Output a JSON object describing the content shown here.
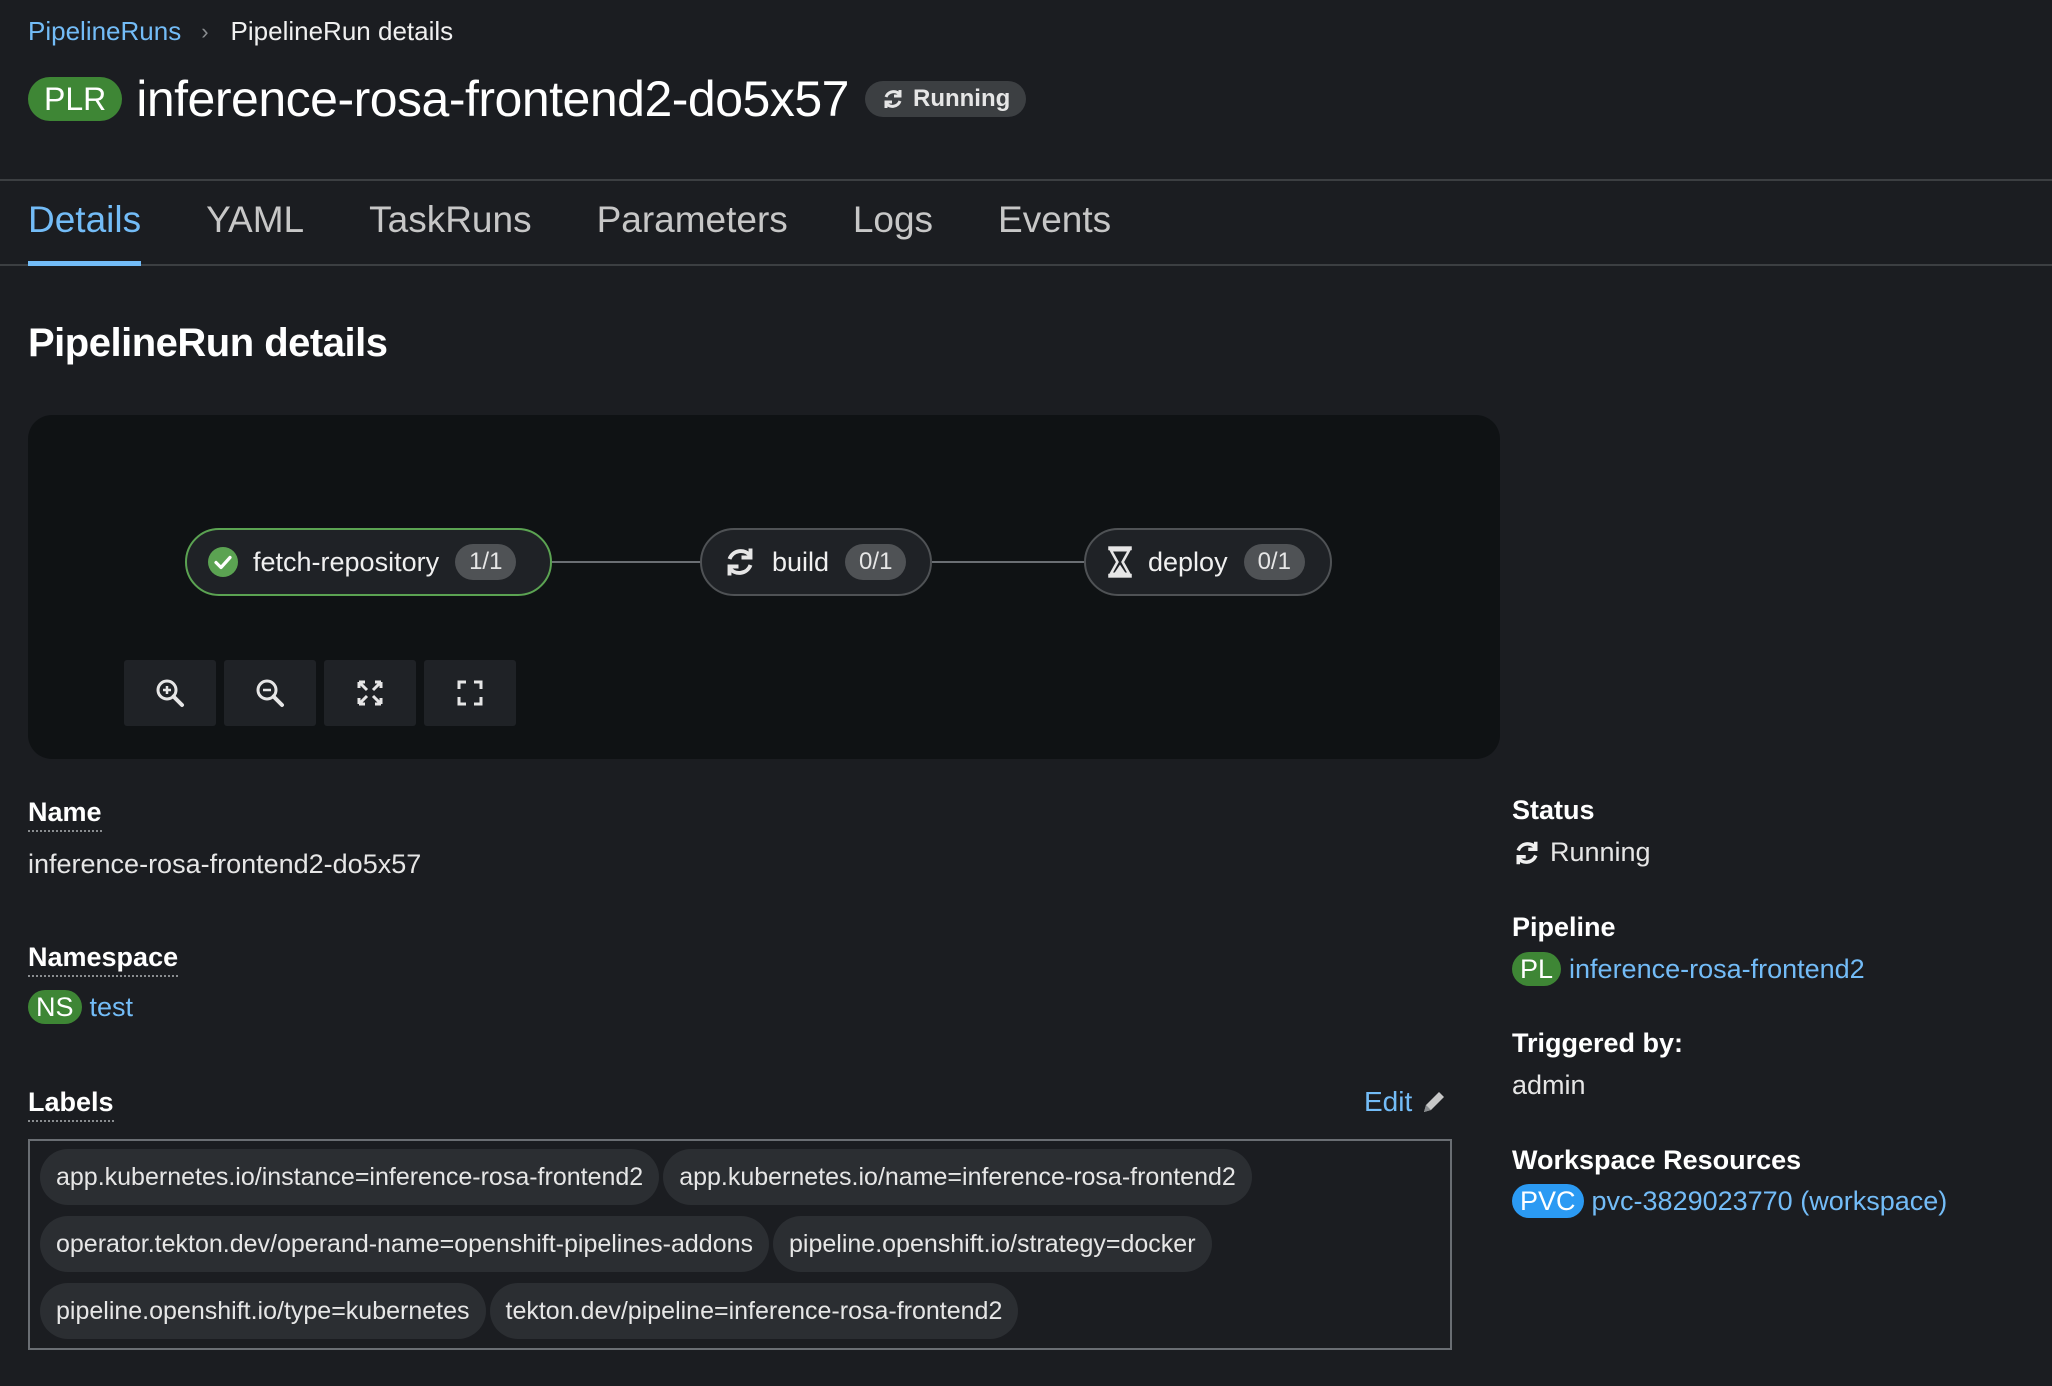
{
  "breadcrumb": {
    "parent": "PipelineRuns",
    "current": "PipelineRun details"
  },
  "header": {
    "badge": "PLR",
    "title": "inference-rosa-frontend2-do5x57",
    "status": "Running"
  },
  "tabs": [
    {
      "label": "Details",
      "active": true
    },
    {
      "label": "YAML",
      "active": false
    },
    {
      "label": "TaskRuns",
      "active": false
    },
    {
      "label": "Parameters",
      "active": false
    },
    {
      "label": "Logs",
      "active": false
    },
    {
      "label": "Events",
      "active": false
    }
  ],
  "section_title": "PipelineRun details",
  "topology": {
    "nodes": [
      {
        "name": "fetch-repository",
        "count": "1/1",
        "state": "success",
        "icon": "check-circle-icon"
      },
      {
        "name": "build",
        "count": "0/1",
        "state": "running",
        "icon": "sync-icon"
      },
      {
        "name": "deploy",
        "count": "0/1",
        "state": "pending",
        "icon": "hourglass-icon"
      }
    ],
    "controls": [
      "zoom-in-icon",
      "zoom-out-icon",
      "fit-to-screen-icon",
      "expand-icon"
    ]
  },
  "details": {
    "name_label": "Name",
    "name_value": "inference-rosa-frontend2-do5x57",
    "namespace_label": "Namespace",
    "namespace_badge": "NS",
    "namespace_value": "test",
    "labels_label": "Labels",
    "edit_label": "Edit",
    "labels": [
      [
        "app.kubernetes.io/instance=inference-rosa-frontend2",
        "app.kubernetes.io/name=inference-rosa-frontend2"
      ],
      [
        "operator.tekton.dev/operand-name=openshift-pipelines-addons",
        "pipeline.openshift.io/strategy=docker"
      ],
      [
        "pipeline.openshift.io/type=kubernetes",
        "tekton.dev/pipeline=inference-rosa-frontend2"
      ]
    ]
  },
  "summary": {
    "status_label": "Status",
    "status_value": "Running",
    "pipeline_label": "Pipeline",
    "pipeline_badge": "PL",
    "pipeline_value": "inference-rosa-frontend2",
    "triggered_label": "Triggered by:",
    "triggered_value": "admin",
    "workspace_label": "Workspace Resources",
    "workspace_badge": "PVC",
    "workspace_value": "pvc-3829023770 (workspace)"
  },
  "colors": {
    "background": "#1b1d21",
    "link": "#73bcf7",
    "success_green": "#3e8635",
    "pvc_blue": "#2b9af3"
  }
}
